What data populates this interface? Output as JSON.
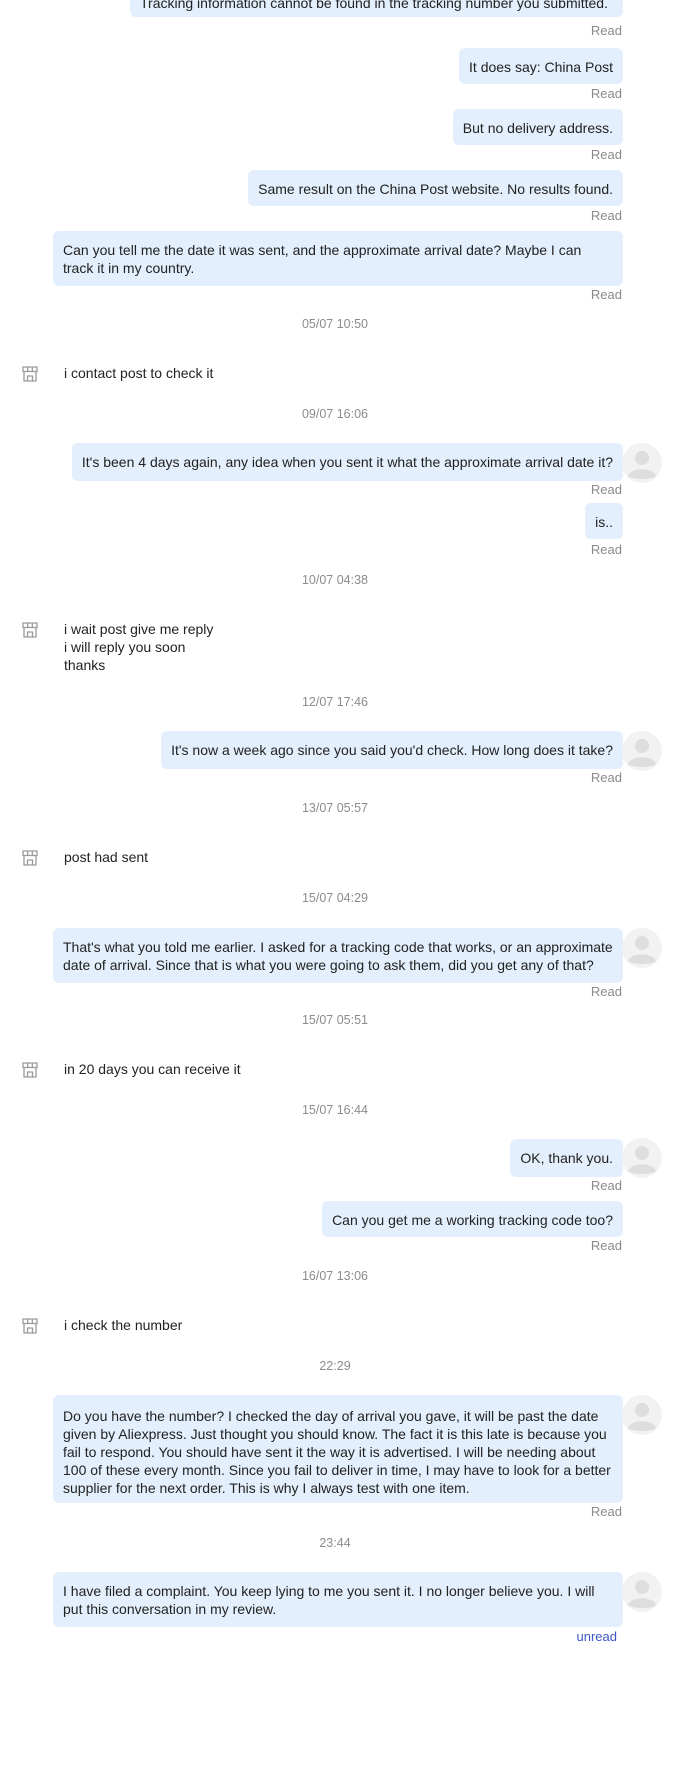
{
  "messages": {
    "m1": "Tracking information cannot be found in the tracking number you submitted.",
    "m2": "It does say: China Post",
    "m3": "But no delivery address.",
    "m4": "Same result on the China Post website. No results found.",
    "m5": "Can you tell me the date it was sent, and the approximate arrival date? Maybe I can track it in my country.",
    "ts1": "05/07 10:50",
    "s1": "i contact post to check it",
    "ts2": "09/07 16:06",
    "m6": "It's been 4 days again, any idea when you sent it what the approximate arrival date it?",
    "m7": "is..",
    "ts3": "10/07 04:38",
    "s2_l1": "i wait post give me reply",
    "s2_l2": "i will reply you soon",
    "s2_l3": "thanks",
    "ts4": "12/07 17:46",
    "m8": "It's now a week ago since you said you'd check. How long does it take?",
    "ts5": "13/07 05:57",
    "s3": "post had sent",
    "ts6": "15/07 04:29",
    "m9": "That's what you told me earlier. I asked for a tracking code that works, or an approximate date of arrival. Since that is what you were going to ask them, did you get any of that?",
    "ts7": "15/07 05:51",
    "s4": "in 20 days you can receive it",
    "ts8": "15/07 16:44",
    "m10": "OK, thank you.",
    "m11": "Can you get me a working tracking code too?",
    "ts9": "16/07 13:06",
    "s5": "i check the number",
    "ts10": "22:29",
    "m12": "Do you have the number? I checked the day of arrival you gave, it will be past the date given by Aliexpress. Just thought you should know. The fact it is this late is because you fail to respond. You should have sent it the way it is advertised. I will be needing about 100 of these every month. Since you fail to deliver in time, I may have to look for a better supplier for the next order. This is why I always test with one item.",
    "ts11": "23:44",
    "m13": "I have filed a complaint. You keep lying to me you sent it. I no longer believe you. I will put this conversation in my review."
  },
  "status": {
    "read": "Read",
    "unread": "unread"
  },
  "colors": {
    "bubble": "#e3effc",
    "unread": "#3b55c4"
  }
}
